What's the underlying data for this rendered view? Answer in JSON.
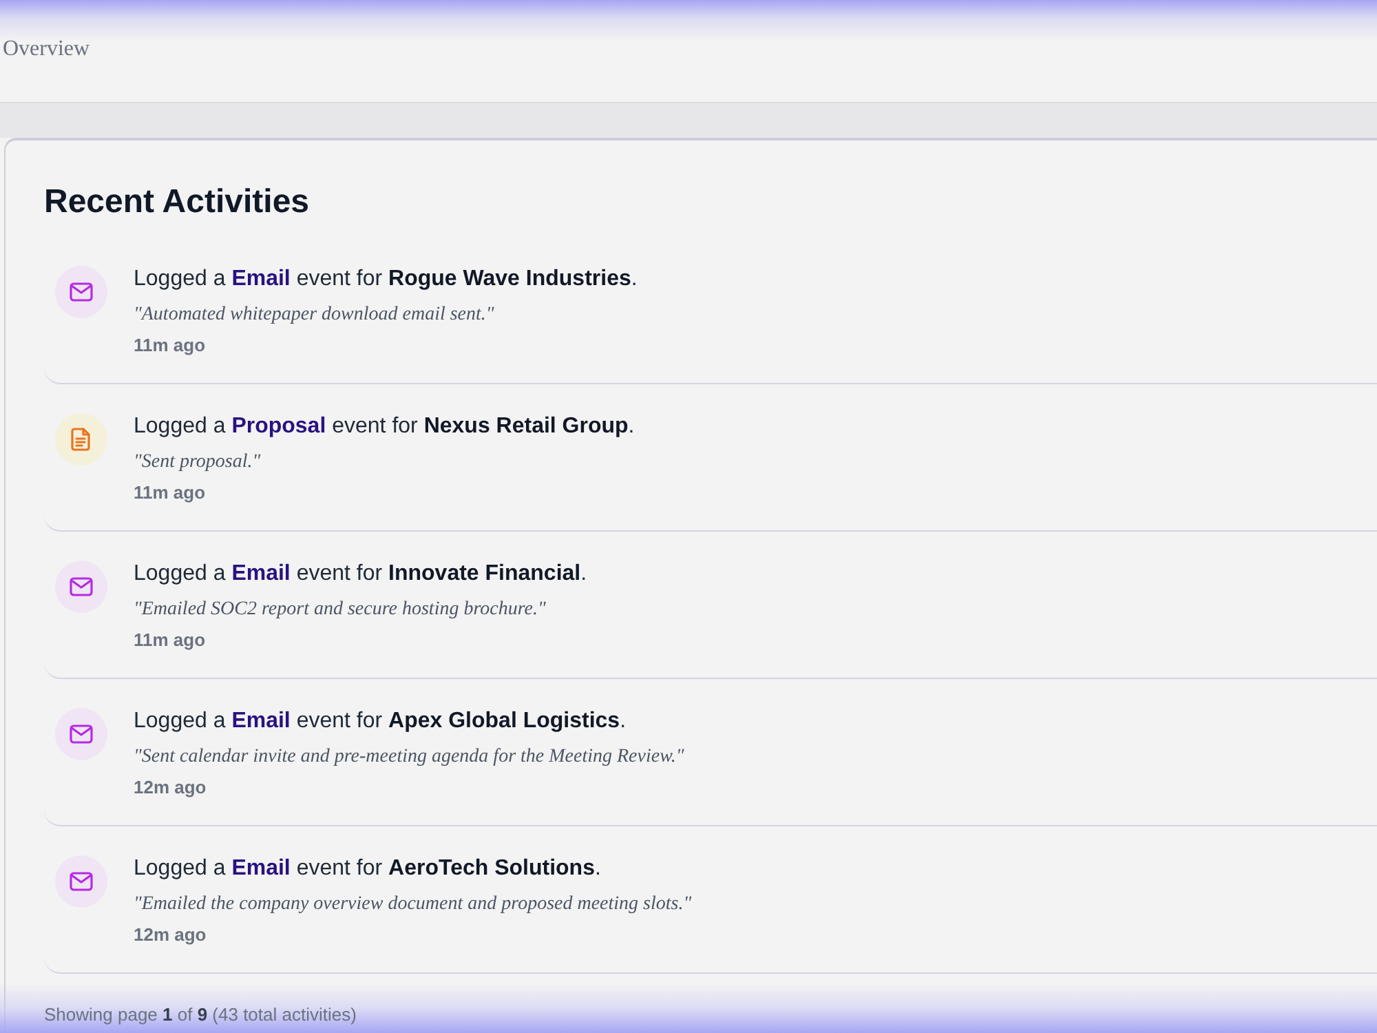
{
  "header": {
    "title": "Overview"
  },
  "activities": {
    "title": "Recent Activities",
    "items": [
      {
        "kind": "email",
        "text": "Logged a **Email** event for **Rogue Wave Industries**.",
        "note": "\"Automated whitepaper download email sent.\"",
        "time": "11m ago"
      },
      {
        "kind": "proposal",
        "text": "Logged a **Proposal** event for **Nexus Retail Group**.",
        "note": "\"Sent proposal.\"",
        "time": "11m ago"
      },
      {
        "kind": "email",
        "text": "Logged a **Email** event for **Innovate Financial**.",
        "note": "\"Emailed SOC2 report and secure hosting brochure.\"",
        "time": "11m ago"
      },
      {
        "kind": "email",
        "text": "Logged a **Email** event for **Apex Global Logistics**.",
        "note": "\"Sent calendar invite and pre-meeting agenda for the Meeting Review.\"",
        "time": "12m ago"
      },
      {
        "kind": "email",
        "text": "Logged a **Email** event for **AeroTech Solutions**.",
        "note": "\"Emailed the company overview document and proposed meeting slots.\"",
        "time": "12m ago"
      }
    ]
  },
  "pagination": {
    "text": "Showing page **1** of **9** (43 total activities)"
  }
}
